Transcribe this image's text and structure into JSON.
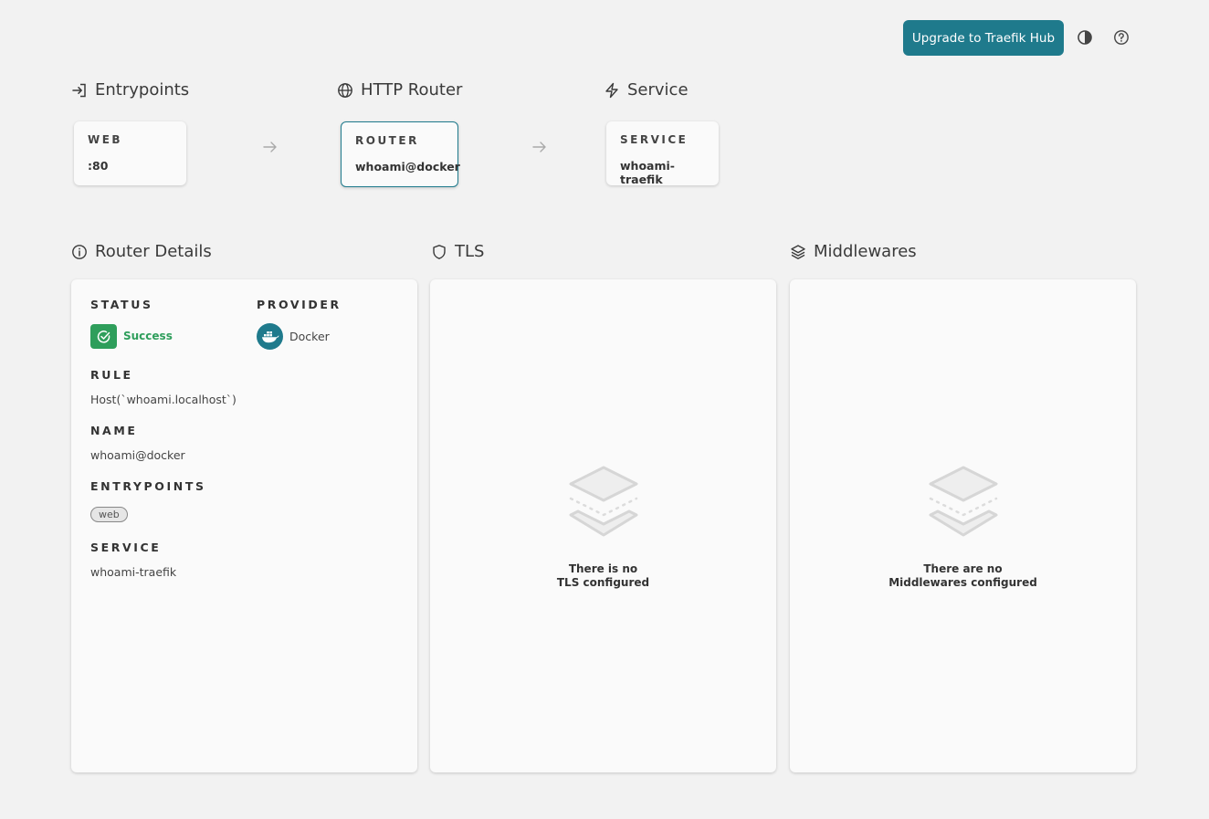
{
  "header": {
    "upgrade_label": "Upgrade to Traefik Hub",
    "theme_icon": "contrast-icon",
    "help_icon": "help-icon"
  },
  "flow": {
    "entrypoints": {
      "title": "Entrypoints",
      "card_caption": "WEB",
      "card_value": ":80"
    },
    "router": {
      "title": "HTTP Router",
      "card_caption": "ROUTER",
      "card_value": "whoami@docker"
    },
    "service": {
      "title": "Service",
      "card_caption": "SERVICE",
      "card_value": "whoami-traefik"
    }
  },
  "details": {
    "title": "Router Details",
    "status_label": "STATUS",
    "status_value": "Success",
    "provider_label": "PROVIDER",
    "provider_value": "Docker",
    "rule_label": "RULE",
    "rule_value": "Host(`whoami.localhost`)",
    "name_label": "NAME",
    "name_value": "whoami@docker",
    "entrypoints_label": "ENTRYPOINTS",
    "entrypoints": [
      "web"
    ],
    "service_label": "SERVICE",
    "service_value": "whoami-traefik"
  },
  "tls": {
    "title": "TLS",
    "empty_line1": "There is no",
    "empty_line2": "TLS configured"
  },
  "middlewares": {
    "title": "Middlewares",
    "empty_line1": "There are no",
    "empty_line2": "Middlewares configured"
  },
  "colors": {
    "accent": "#1f7a8c",
    "success": "#2e9e5b",
    "background": "#f2f2f2",
    "card": "#fafafa"
  }
}
